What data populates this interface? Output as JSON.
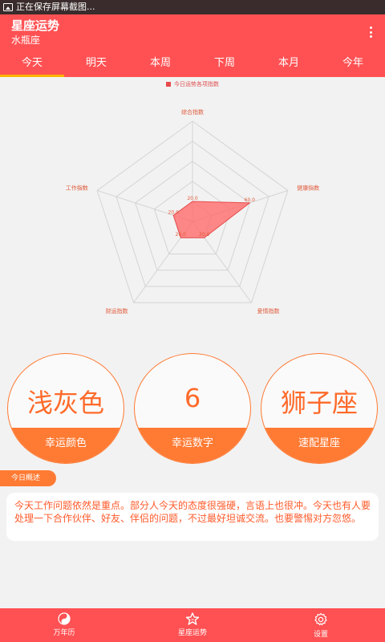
{
  "status": {
    "notification_text": "正在保存屏幕截图..."
  },
  "app": {
    "title": "星座运势",
    "subtitle": "水瓶座"
  },
  "tabs": [
    {
      "label": "今天",
      "active": true
    },
    {
      "label": "明天",
      "active": false
    },
    {
      "label": "本周",
      "active": false
    },
    {
      "label": "下周",
      "active": false
    },
    {
      "label": "本月",
      "active": false
    },
    {
      "label": "今年",
      "active": false
    }
  ],
  "chart_data": {
    "type": "radar",
    "legend": "今日运势各项指数",
    "axes": [
      "综合指数",
      "健康指数",
      "爱情指数",
      "财运指数",
      "工作指数"
    ],
    "values": [
      20,
      60,
      20,
      20,
      20
    ],
    "max": 100,
    "value_labels": [
      "20.0",
      "60.0",
      "20.0",
      "20.0",
      "20.0"
    ],
    "colors": {
      "fill": "#ff6b6b",
      "stroke": "#e84a4a",
      "grid": "#d4d4d4",
      "label": "#e05a3a"
    }
  },
  "cards": [
    {
      "value": "浅灰色",
      "label": "幸运颜色"
    },
    {
      "value": "6",
      "label": "幸运数字"
    },
    {
      "value": "狮子座",
      "label": "速配星座"
    }
  ],
  "summary": {
    "title": "今日概述",
    "text": "今天工作问题依然是重点。部分人今天的态度很强硬，言语上也很冲。今天也有人要处理一下合作伙伴、好友、伴侣的问题，不过最好坦诚交流。也要警惕对方忽悠。"
  },
  "bottom_nav": [
    {
      "label": "万年历",
      "icon": "yin-yang-icon",
      "active": false
    },
    {
      "label": "星座运势",
      "icon": "star-icon",
      "active": true
    },
    {
      "label": "设置",
      "icon": "gear-icon",
      "active": false
    }
  ]
}
